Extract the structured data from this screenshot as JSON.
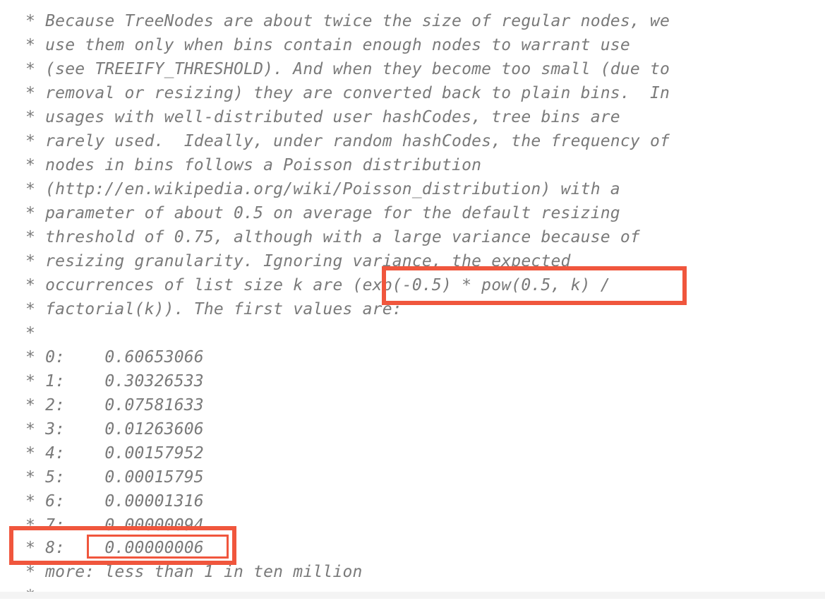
{
  "comment_lines": [
    "* Because TreeNodes are about twice the size of regular nodes, we",
    "* use them only when bins contain enough nodes to warrant use",
    "* (see TREEIFY_THRESHOLD). And when they become too small (due to",
    "* removal or resizing) they are converted back to plain bins.  In",
    "* usages with well-distributed user hashCodes, tree bins are",
    "* rarely used.  Ideally, under random hashCodes, the frequency of",
    "* nodes in bins follows a Poisson distribution",
    "* (http://en.wikipedia.org/wiki/Poisson_distribution) with a",
    "* parameter of about 0.5 on average for the default resizing",
    "* threshold of 0.75, although with a large variance because of",
    "* resizing granularity. Ignoring variance, the expected",
    "* occurrences of list size k are (exp(-0.5) * pow(0.5, k) /",
    "* factorial(k)). The first values are:",
    "*",
    "* 0:    0.60653066",
    "* 1:    0.30326533",
    "* 2:    0.07581633",
    "* 3:    0.01263606",
    "* 4:    0.00157952",
    "* 5:    0.00015795",
    "* 6:    0.00001316",
    "* 7:    0.00000094",
    "* 8:    0.00000006",
    "* more: less than 1 in ten million",
    "*"
  ],
  "highlight_color": "#f0563d"
}
